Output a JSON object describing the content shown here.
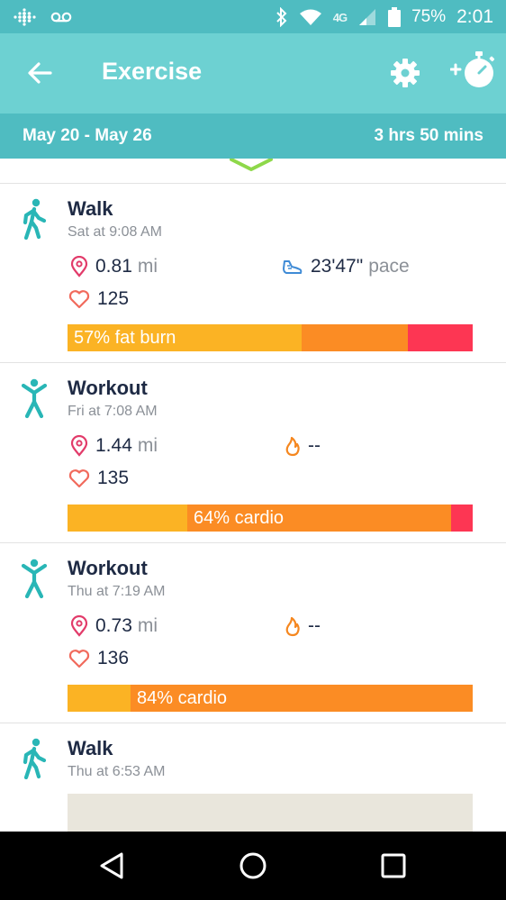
{
  "status_bar": {
    "network": "4G",
    "battery": "75%",
    "time": "2:01"
  },
  "header": {
    "title": "Exercise",
    "back_icon": "arrow-left-icon",
    "settings_icon": "gear-icon",
    "add_exercise_icon": "add-stopwatch-icon"
  },
  "summary": {
    "date_range": "May 20 - May 26",
    "total_duration": "3 hrs 50 mins"
  },
  "activities": [
    {
      "name": "Walk",
      "time": "Sat at 9:08 AM",
      "activity_icon": "walk-icon",
      "distance": "0.81",
      "distance_unit": "mi",
      "heart_rate": "125",
      "secondary_value": "23'47\"",
      "secondary_unit": "pace",
      "secondary_icon": "shoe-icon",
      "zone_label": "57% fat burn",
      "zones": {
        "fat_burn": 0.577,
        "cardio": 0.262,
        "peak": 0.161
      }
    },
    {
      "name": "Workout",
      "time": "Fri at 7:08 AM",
      "activity_icon": "workout-icon",
      "distance": "1.44",
      "distance_unit": "mi",
      "heart_rate": "135",
      "secondary_value": "--",
      "secondary_unit": "",
      "secondary_icon": "flame-icon",
      "zone_label": "64% cardio",
      "zones": {
        "fat_burn": 0.296,
        "cardio": 0.65,
        "peak": 0.054
      }
    },
    {
      "name": "Workout",
      "time": "Thu at 7:19 AM",
      "activity_icon": "workout-icon",
      "distance": "0.73",
      "distance_unit": "mi",
      "heart_rate": "136",
      "secondary_value": "--",
      "secondary_unit": "",
      "secondary_icon": "flame-icon",
      "zone_label": "84% cardio",
      "zones": {
        "fat_burn": 0.156,
        "cardio": 0.844,
        "peak": 0
      }
    },
    {
      "name": "Walk",
      "time": "Thu at 6:53 AM",
      "activity_icon": "walk-icon"
    }
  ],
  "colors": {
    "header": "#6dd1d2",
    "summary": "#4fbcc1",
    "fat_burn": "#fbb324",
    "cardio": "#fb8c24",
    "peak": "#fd3653",
    "location": "#e23b6a",
    "heart": "#f16a5c",
    "pace": "#3f8bd6",
    "flame": "#f5871f"
  },
  "nav_bar": {
    "back_icon": "triangle-back-icon",
    "home_icon": "circle-home-icon",
    "recents_icon": "square-recents-icon"
  }
}
